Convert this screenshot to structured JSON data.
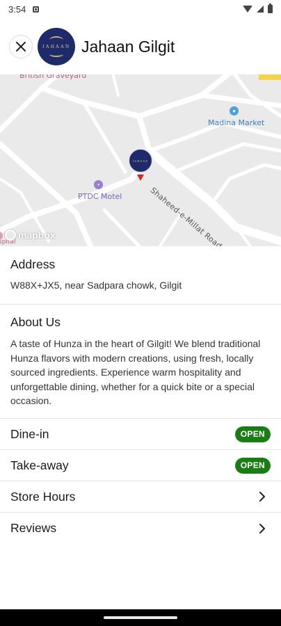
{
  "status_bar": {
    "time": "3:54"
  },
  "header": {
    "restaurant_name": "Jahaan Gilgit",
    "logo_text": "JAHAAN"
  },
  "map": {
    "labels": {
      "top_left": "British Graveyard",
      "poi_market": "Madina Market",
      "poi_motel": "PTDC Motel",
      "road": "Shaheed-e-Millat Road",
      "edge": "spital"
    },
    "attribution": "mapbox",
    "marker_logo_text": "JAHAAN"
  },
  "address": {
    "title": "Address",
    "value": "W88X+JX5, near Sadpara chowk, Gilgit"
  },
  "about": {
    "title": "About Us",
    "text": "A taste of Hunza in the heart of Gilgit! We blend traditional Hunza flavors with modern creations, using fresh, locally sourced ingredients. Experience warm hospitality and unforgettable dining, whether for a quick bite or a special occasion."
  },
  "rows": {
    "dine_in": {
      "label": "Dine-in",
      "status": "OPEN"
    },
    "take_away": {
      "label": "Take-away",
      "status": "OPEN"
    },
    "store_hours": {
      "label": "Store Hours"
    },
    "reviews": {
      "label": "Reviews"
    }
  },
  "colors": {
    "open_badge": "#1a7d14",
    "brand_navy": "#1f2a6b",
    "pin_red": "#e02020"
  }
}
